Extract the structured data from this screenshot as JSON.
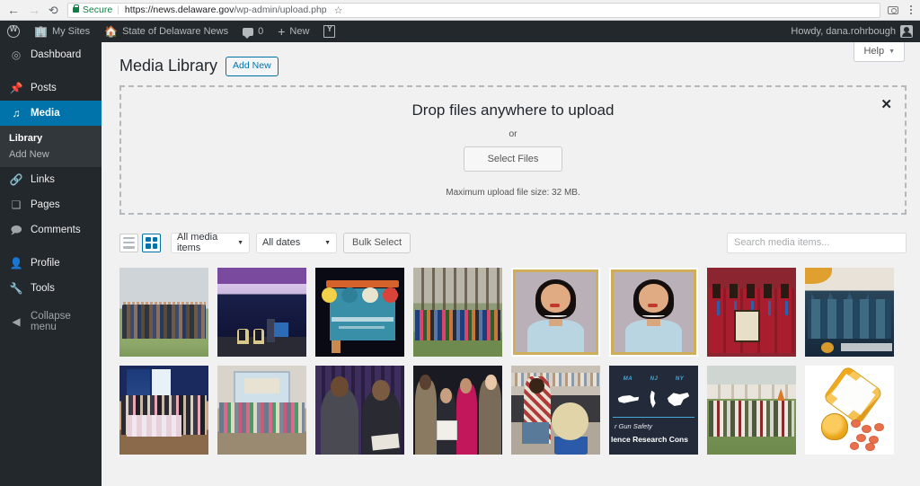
{
  "browser": {
    "back_icon": "back-arrow-icon",
    "forward_icon": "forward-arrow-icon",
    "reload_icon": "reload-icon",
    "secure_label": "Secure",
    "url_host": "https://news.delaware.gov",
    "url_path": "/wp-admin/upload.php",
    "star_icon": "bookmark-star-icon",
    "camera_icon": "camera-icon",
    "menu_icon": "kebab-menu-icon"
  },
  "adminbar": {
    "wp_logo": "wordpress-logo-icon",
    "my_sites": "My Sites",
    "site_name": "State of Delaware News",
    "comment_count": "0",
    "new_label": "New",
    "yoast_icon": "yoast-seo-icon",
    "howdy": "Howdy, dana.rohrbough",
    "avatar_icon": "user-avatar-icon"
  },
  "sidebar": {
    "items": [
      {
        "label": "Dashboard",
        "icon": "dashboard-icon",
        "glyph": "◉"
      },
      {
        "label": "Posts",
        "icon": "pin-icon",
        "glyph": "📌"
      },
      {
        "label": "Media",
        "icon": "media-icon",
        "glyph": "♫"
      },
      {
        "label": "Links",
        "icon": "link-icon",
        "glyph": "🔗"
      },
      {
        "label": "Pages",
        "icon": "pages-icon",
        "glyph": "❐"
      },
      {
        "label": "Comments",
        "icon": "comment-icon",
        "glyph": "💬"
      },
      {
        "label": "Profile",
        "icon": "profile-icon",
        "glyph": "👤"
      },
      {
        "label": "Tools",
        "icon": "tools-icon",
        "glyph": "🔧"
      },
      {
        "label": "Collapse menu",
        "icon": "collapse-icon",
        "glyph": "◀"
      }
    ],
    "submenu": [
      {
        "label": "Library",
        "current": true
      },
      {
        "label": "Add New",
        "current": false
      }
    ],
    "active_item": "Media",
    "accent_color": "#0073aa"
  },
  "header": {
    "help_label": "Help",
    "help_caret": "chevron-down-icon",
    "page_title": "Media Library",
    "add_new_label": "Add New"
  },
  "uploader": {
    "drop_title": "Drop files anywhere to upload",
    "or_label": "or",
    "select_files_label": "Select Files",
    "max_size_note": "Maximum upload file size: 32 MB.",
    "close_label": "✕"
  },
  "toolbar": {
    "list_view_icon": "list-view-icon",
    "grid_view_icon": "grid-view-icon",
    "media_filter": "All media items",
    "dates_filter": "All dates",
    "bulk_select_label": "Bulk Select",
    "search_placeholder": "Search media items...",
    "search_value": ""
  },
  "media_items": [
    {
      "alt": "Group photo outdoors on grass",
      "art": "t-group-field"
    },
    {
      "alt": "Conference stage with speakers and purple lighting",
      "art": "t-stage"
    },
    {
      "alt": "Delaware Pathways Conference sign board",
      "art": "t-signboard"
    },
    {
      "alt": "Large group in the woods",
      "art": "t-woods"
    },
    {
      "alt": "Portrait of woman in light blue top",
      "art": "t-portrait"
    },
    {
      "alt": "Portrait of woman in light blue top (duplicate)",
      "art": "t-portrait"
    },
    {
      "alt": "Students in red shirts with medals holding framed art",
      "art": "t-medals"
    },
    {
      "alt": "Mural painting of cathedral spires",
      "art": "t-mural"
    },
    {
      "alt": "Award ceremony group with blue banner",
      "art": "t-award-blue"
    },
    {
      "alt": "Children on stage with projection screen",
      "art": "t-kids-stage"
    },
    {
      "alt": "Two men speaking at podium",
      "art": "t-podium-men"
    },
    {
      "alt": "Four people with certificate",
      "art": "t-award-four"
    },
    {
      "alt": "Student working on pottery in workshop",
      "art": "t-workshop"
    },
    {
      "alt": "Gun Safety and Violence Research Consortium graphic",
      "art": "t-gunsafety"
    },
    {
      "alt": "Team group photo on a field",
      "art": "t-team-field"
    },
    {
      "alt": "Prescription pill bottle with spilled tablets",
      "art": "t-pills"
    }
  ],
  "gunsafety_graphic": {
    "state_labels": [
      "MA",
      "NJ",
      "NY"
    ],
    "line1": "r Gun Safety",
    "line2": "lence Research Cons"
  }
}
